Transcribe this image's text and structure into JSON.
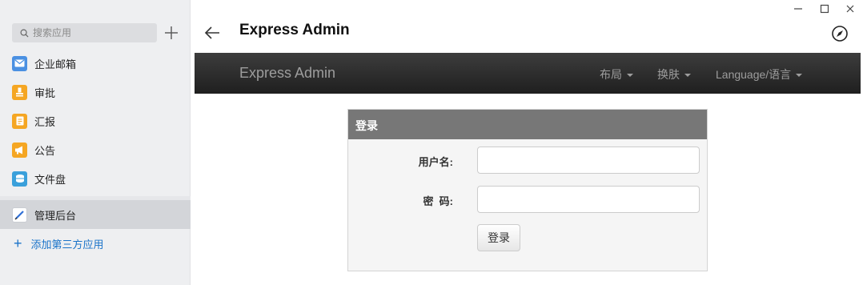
{
  "sidebar": {
    "search_placeholder": "搜索应用",
    "items": [
      {
        "label": "企业邮箱",
        "icon": "mail-icon",
        "color": "#4a90e2"
      },
      {
        "label": "审批",
        "icon": "approval-icon",
        "color": "#f5a623"
      },
      {
        "label": "汇报",
        "icon": "report-icon",
        "color": "#f5a623"
      },
      {
        "label": "公告",
        "icon": "announcement-icon",
        "color": "#f5a623"
      },
      {
        "label": "文件盘",
        "icon": "file-disk-icon",
        "color": "#3aa0db"
      },
      {
        "label": "管理后台",
        "icon": "admin-icon",
        "color": "#2f6fd6"
      }
    ],
    "add_app_label": "添加第三方应用"
  },
  "header": {
    "title": "Express Admin"
  },
  "webapp": {
    "brand": "Express Admin",
    "menus": [
      "布局",
      "换肤",
      "Language/语言"
    ],
    "login_panel": {
      "title": "登录",
      "username_label": "用户名:",
      "password_label": "密  码:",
      "username_value": "",
      "password_value": "",
      "submit_label": "登录"
    }
  },
  "colors": {
    "accent": "#1a73c9",
    "navbar": "#2a2a2a",
    "panel_head": "#777777"
  }
}
